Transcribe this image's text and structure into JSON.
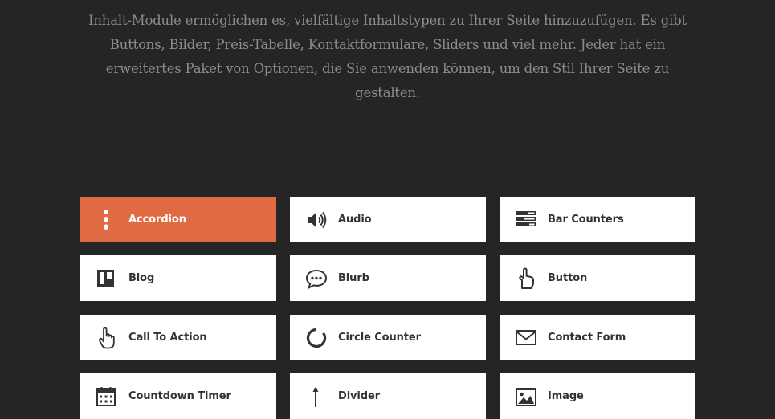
{
  "intro": {
    "text": "Inhalt-Module ermöglichen es, vielfältige Inhaltstypen zu Ihrer Seite hinzuzufügen. Es gibt Buttons, Bilder, Preis-Tabelle, Kontaktformulare, Sliders und viel mehr. Jeder hat ein erweitertes Paket von Optionen, die Sie anwenden können, um den Stil Ihrer Seite zu gestalten."
  },
  "colors": {
    "background": "#252525",
    "accent": "#e06b43",
    "tile": "#ffffff",
    "tile_text": "#333333",
    "intro_text": "#8c8c8c"
  },
  "modules": [
    {
      "label": "Accordion",
      "icon": "accordion-icon",
      "active": true
    },
    {
      "label": "Audio",
      "icon": "audio-icon",
      "active": false
    },
    {
      "label": "Bar Counters",
      "icon": "bar-counters-icon",
      "active": false
    },
    {
      "label": "Blog",
      "icon": "blog-icon",
      "active": false
    },
    {
      "label": "Blurb",
      "icon": "blurb-icon",
      "active": false
    },
    {
      "label": "Button",
      "icon": "button-icon",
      "active": false
    },
    {
      "label": "Call To Action",
      "icon": "call-to-action-icon",
      "active": false
    },
    {
      "label": "Circle Counter",
      "icon": "circle-counter-icon",
      "active": false
    },
    {
      "label": "Contact Form",
      "icon": "contact-form-icon",
      "active": false
    },
    {
      "label": "Countdown Timer",
      "icon": "countdown-timer-icon",
      "active": false
    },
    {
      "label": "Divider",
      "icon": "divider-icon",
      "active": false
    },
    {
      "label": "Image",
      "icon": "image-icon",
      "active": false
    }
  ]
}
